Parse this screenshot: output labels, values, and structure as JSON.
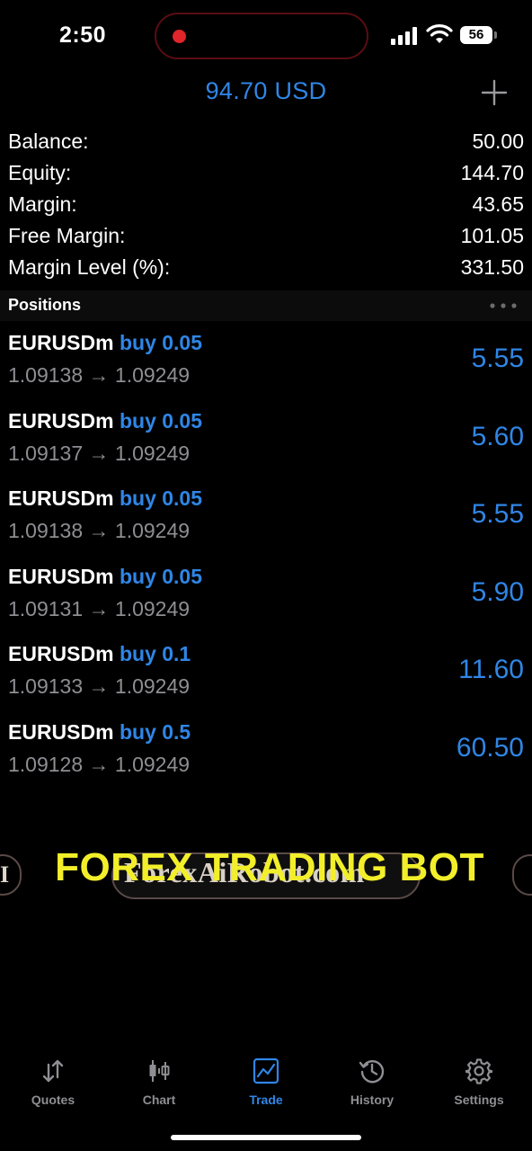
{
  "status_bar": {
    "time": "2:50",
    "battery": "56"
  },
  "header": {
    "title": "94.70 USD"
  },
  "summary": [
    {
      "label": "Balance:",
      "value": "50.00"
    },
    {
      "label": "Equity:",
      "value": "144.70"
    },
    {
      "label": "Margin:",
      "value": "43.65"
    },
    {
      "label": "Free Margin:",
      "value": "101.05"
    },
    {
      "label": "Margin Level (%):",
      "value": "331.50"
    }
  ],
  "positions": {
    "title": "Positions",
    "items": [
      {
        "symbol": "EURUSDm",
        "side": "buy 0.05",
        "prices": "1.09138 → 1.09249",
        "profit": "5.55"
      },
      {
        "symbol": "EURUSDm",
        "side": "buy 0.05",
        "prices": "1.09137 → 1.09249",
        "profit": "5.60"
      },
      {
        "symbol": "EURUSDm",
        "side": "buy 0.05",
        "prices": "1.09138 → 1.09249",
        "profit": "5.55"
      },
      {
        "symbol": "EURUSDm",
        "side": "buy 0.05",
        "prices": "1.09131 → 1.09249",
        "profit": "5.90"
      },
      {
        "symbol": "EURUSDm",
        "side": "buy 0.1",
        "prices": "1.09133 → 1.09249",
        "profit": "11.60"
      },
      {
        "symbol": "EURUSDm",
        "side": "buy 0.5",
        "prices": "1.09128 → 1.09249",
        "profit": "60.50"
      }
    ]
  },
  "overlay": {
    "caption": "FOREX TRADING BOT",
    "watermark": "ForexAiRobot.com",
    "edge_glyph": "I"
  },
  "tabs": [
    {
      "label": "Quotes",
      "icon": "quotes-arrows-icon",
      "active": false
    },
    {
      "label": "Chart",
      "icon": "candlestick-icon",
      "active": false
    },
    {
      "label": "Trade",
      "icon": "trade-chart-icon",
      "active": true
    },
    {
      "label": "History",
      "icon": "history-clock-icon",
      "active": false
    },
    {
      "label": "Settings",
      "icon": "gear-icon",
      "active": false
    }
  ],
  "colors": {
    "accent": "#2f86e6",
    "background": "#000000",
    "secondary_text": "#8e8e93",
    "caption": "#f2ef2a",
    "recording": "#e0252b"
  }
}
